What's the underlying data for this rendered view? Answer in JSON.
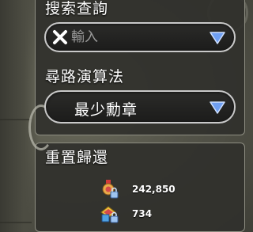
{
  "search": {
    "heading": "搜索查詢",
    "placeholder": "輸入",
    "input_value": "",
    "clear_icon": "x-icon",
    "dropdown_icon": "triangle-down-icon"
  },
  "pathfinding": {
    "heading": "尋路演算法",
    "selected": "最少勳章",
    "dropdown_icon": "triangle-down-icon"
  },
  "reset": {
    "heading": "重置歸還",
    "items": [
      {
        "icon": "medal-lock-icon",
        "value": "242,850"
      },
      {
        "icon": "coin-lock-icon",
        "value": "734"
      }
    ]
  },
  "colors": {
    "dropdown_arrow": "#6f9ff2",
    "panel_border": "#8e8e82",
    "field_border": "#c9c9c9"
  }
}
